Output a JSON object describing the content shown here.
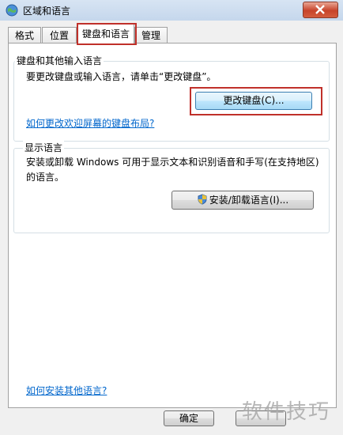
{
  "window": {
    "title": "区域和语言"
  },
  "tabs": [
    {
      "label": "格式"
    },
    {
      "label": "位置"
    },
    {
      "label": "键盘和语言"
    },
    {
      "label": "管理"
    }
  ],
  "keyboard_group": {
    "title": "键盘和其他输入语言",
    "description": "要更改键盘或输入语言，请单击“更改键盘”。",
    "button_label": "更改键盘(C)...",
    "link": "如何更改欢迎屏幕的键盘布局?"
  },
  "display_group": {
    "title": "显示语言",
    "description": "安装或卸载 Windows 可用于显示文本和识别语音和手写(在支持地区)的语言。",
    "button_label": "安装/卸载语言(I)..."
  },
  "footer": {
    "link": "如何安装其他语言?",
    "ok_label": "确定"
  },
  "watermark": "软件技巧",
  "colors": {
    "highlight": "#c0302a",
    "link": "#0066cc"
  }
}
